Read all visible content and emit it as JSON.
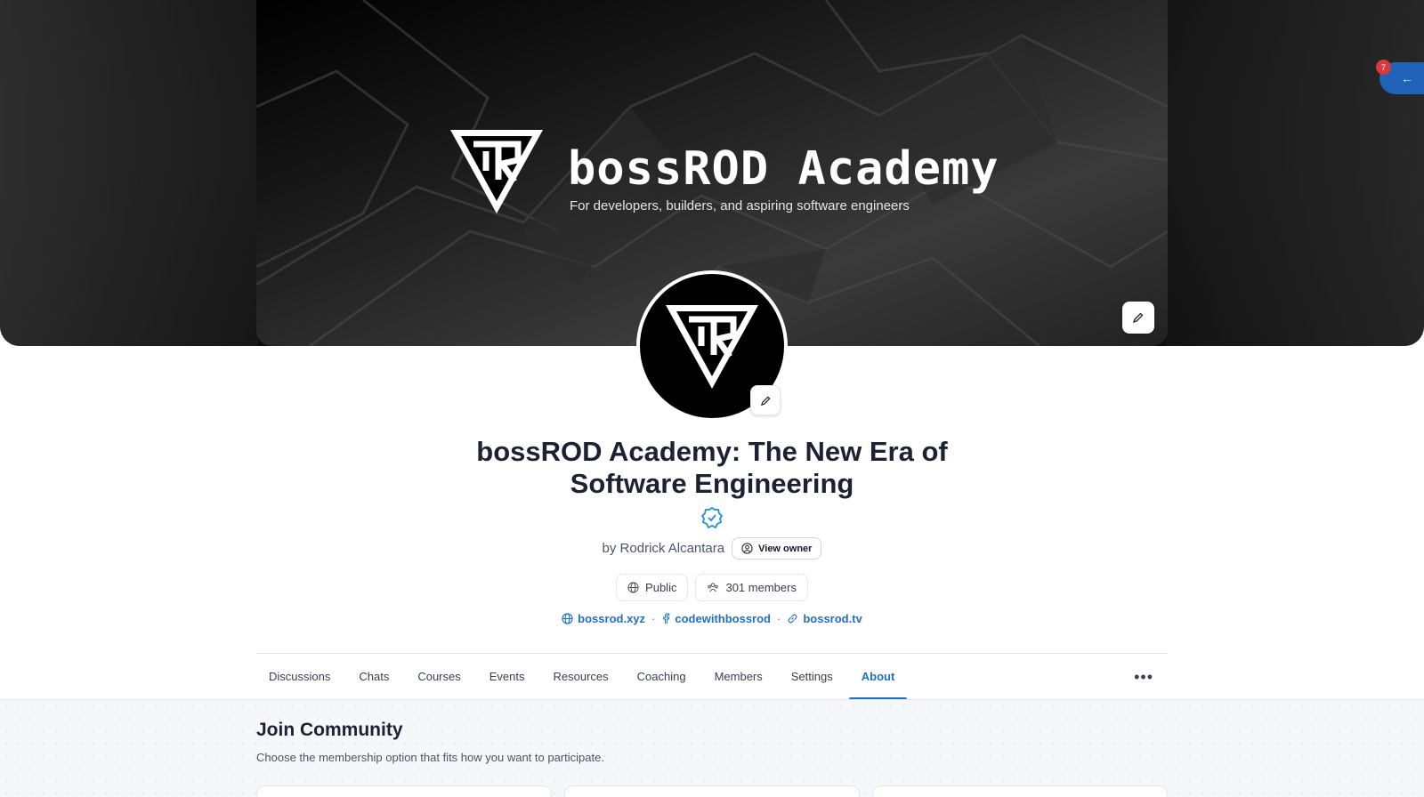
{
  "banner": {
    "title": "bossROD Academy",
    "tagline": "For developers, builders, and aspiring software engineers"
  },
  "notification": {
    "count": "7"
  },
  "community": {
    "title": "bossROD Academy: The New Era of Software Engineering",
    "owner_text": "by Rodrick Alcantara",
    "view_owner_label": "View owner",
    "visibility": "Public",
    "members": "301 members",
    "links": [
      {
        "label": "bossrod.xyz",
        "icon": "globe-icon"
      },
      {
        "label": "codewithbossrod",
        "icon": "facebook-icon"
      },
      {
        "label": "bossrod.tv",
        "icon": "link-icon"
      }
    ]
  },
  "nav": {
    "tabs": [
      "Discussions",
      "Chats",
      "Courses",
      "Events",
      "Resources",
      "Coaching",
      "Members",
      "Settings",
      "About"
    ],
    "active": "About",
    "more_label": "•••"
  },
  "join": {
    "title": "Join Community",
    "subtitle": "Choose the membership option that fits how you want to participate."
  },
  "colors": {
    "accent": "#1f6fc4",
    "title": "#1b2233",
    "banner_bg": "#111111"
  }
}
